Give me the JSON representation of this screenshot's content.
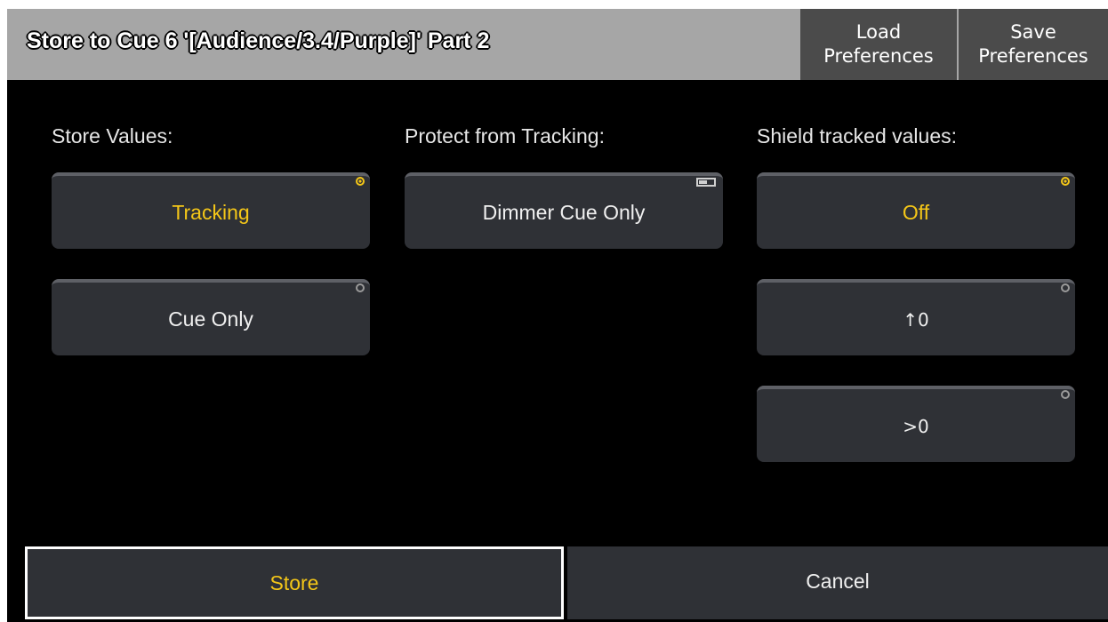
{
  "dialog": {
    "title": "Store to Cue 6 '[Audience/3.4/Purple]' Part 2",
    "load_preferences": [
      "Load",
      "Preferences"
    ],
    "save_preferences": [
      "Save",
      "Preferences"
    ]
  },
  "columns": {
    "store_values": {
      "label": "Store Values:",
      "options": [
        "Tracking",
        "Cue Only"
      ],
      "selected": "Tracking"
    },
    "protect_from_tracking": {
      "label": "Protect from Tracking:",
      "options": [
        "Dimmer Cue Only"
      ]
    },
    "shield_tracked_values": {
      "label": "Shield tracked values:",
      "options": [
        "Off",
        "↑0",
        ">0"
      ],
      "selected": "Off"
    }
  },
  "actions": {
    "store": "Store",
    "cancel": "Cancel"
  },
  "colors": {
    "accent": "#f4c618",
    "button": "#2f3136",
    "titlebar": "#a6a6a6"
  }
}
